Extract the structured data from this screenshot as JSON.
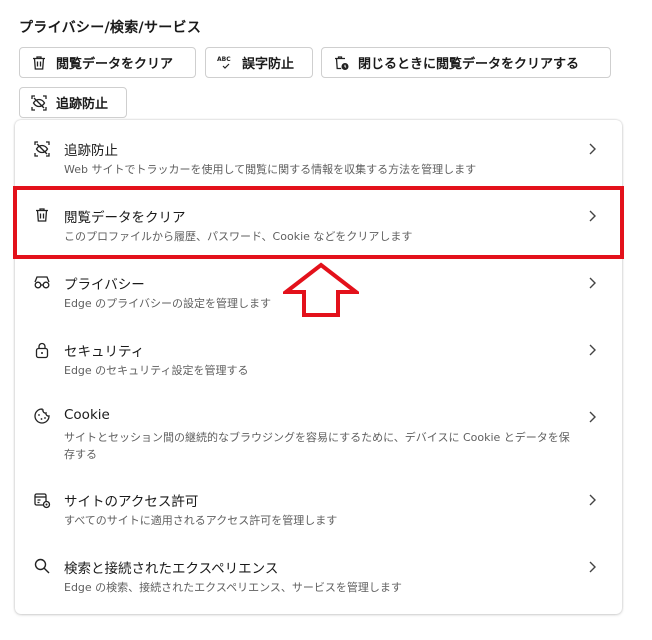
{
  "page": {
    "title": "プライバシー/検索/サービス"
  },
  "quick_actions": [
    {
      "label": "閲覧データをクリア",
      "icon": "trash-icon"
    },
    {
      "label": "誤字防止",
      "icon": "spellcheck-icon"
    },
    {
      "label": "閉じるときに閲覧データをクリアする",
      "icon": "trash-clock-icon"
    },
    {
      "label": "追跡防止",
      "icon": "tracking-prevention-icon"
    }
  ],
  "settings": [
    {
      "title": "追跡防止",
      "desc": "Web サイトでトラッカーを使用して閲覧に関する情報を収集する方法を管理します",
      "icon": "tracking-prevention-icon"
    },
    {
      "title": "閲覧データをクリア",
      "desc": "このプロファイルから履歴、パスワード、Cookie などをクリアします",
      "icon": "trash-icon"
    },
    {
      "title": "プライバシー",
      "desc": "Edge のプライバシーの設定を管理します",
      "icon": "glasses-icon"
    },
    {
      "title": "セキュリティ",
      "desc": "Edge のセキュリティ設定を管理する",
      "icon": "lock-icon"
    },
    {
      "title": "Cookie",
      "desc": "サイトとセッション間の継続的なブラウジングを容易にするために、デバイスに Cookie とデータを保存する",
      "icon": "cookie-icon"
    },
    {
      "title": "サイトのアクセス許可",
      "desc": "すべてのサイトに適用されるアクセス許可を管理します",
      "icon": "site-permissions-icon"
    },
    {
      "title": "検索と接続されたエクスペリエンス",
      "desc": "Edge の検索、接続されたエクスペリエンス、サービスを管理します",
      "icon": "search-icon"
    }
  ],
  "annotation": {
    "highlight_color": "#e3111b",
    "highlighted_item": "閲覧データをクリア"
  }
}
